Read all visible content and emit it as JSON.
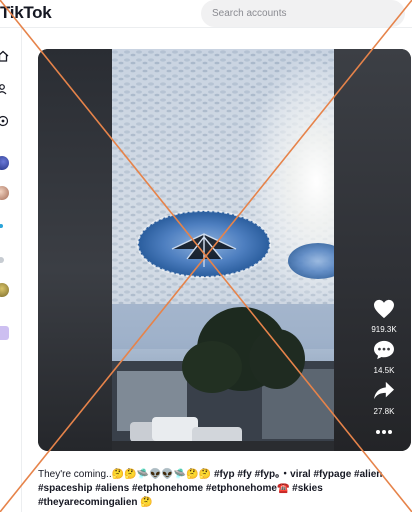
{
  "header": {
    "logo": "TikTok",
    "search_placeholder": "Search accounts"
  },
  "sidebar": {
    "icons": [
      "home-icon",
      "following-icon",
      "explore-icon"
    ],
    "accent_color": "#fe2c55"
  },
  "video": {
    "like_count": "919.3K",
    "comment_count": "14.5K",
    "share_count": "27.8K",
    "more_icon": "ellipsis-icon"
  },
  "caption": {
    "text": "They're coming..🤔🤔🛸👽👽🛸🤔🤔",
    "hashtags": "#fyp #fy #fyp。・viral #fypage #alien #spaceship #aliens #etphonehome #etphonehome☎️ #skies #theyarecomingalien 🤔"
  }
}
